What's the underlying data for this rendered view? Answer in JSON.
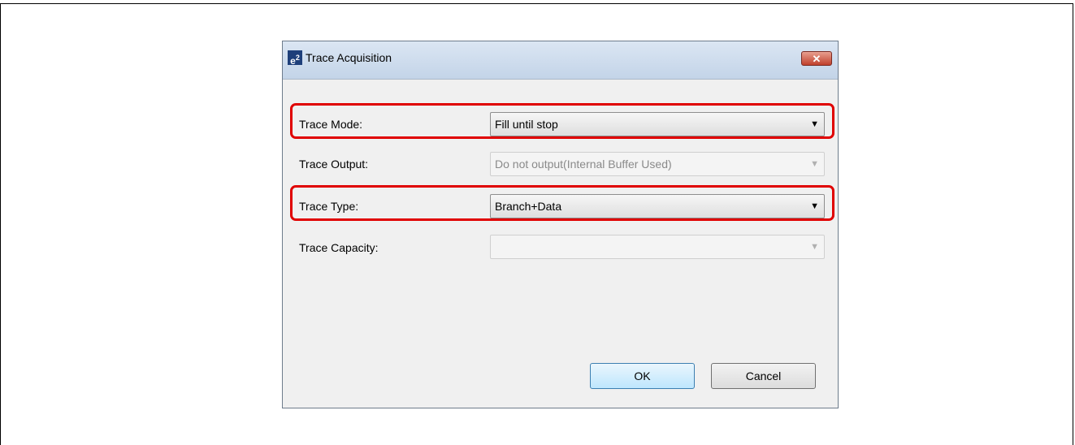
{
  "dialog": {
    "title": "Trace Acquisition",
    "icon_label": "e",
    "icon_sup": "2",
    "close_label": "✕"
  },
  "fields": {
    "trace_mode": {
      "label": "Trace Mode:",
      "value": "Fill until stop",
      "enabled": true
    },
    "trace_output": {
      "label": "Trace Output:",
      "value": "Do not output(Internal Buffer Used)",
      "enabled": false
    },
    "trace_type": {
      "label": "Trace Type:",
      "value": "Branch+Data",
      "enabled": true
    },
    "trace_capacity": {
      "label": "Trace Capacity:",
      "value": "",
      "enabled": false
    }
  },
  "buttons": {
    "ok": "OK",
    "cancel": "Cancel"
  },
  "icons": {
    "dropdown": "chevron-down-icon",
    "close": "close-icon",
    "app": "e2-app-icon"
  },
  "colors": {
    "highlight": "#e00000",
    "titlebar": "#c3d4e8"
  }
}
